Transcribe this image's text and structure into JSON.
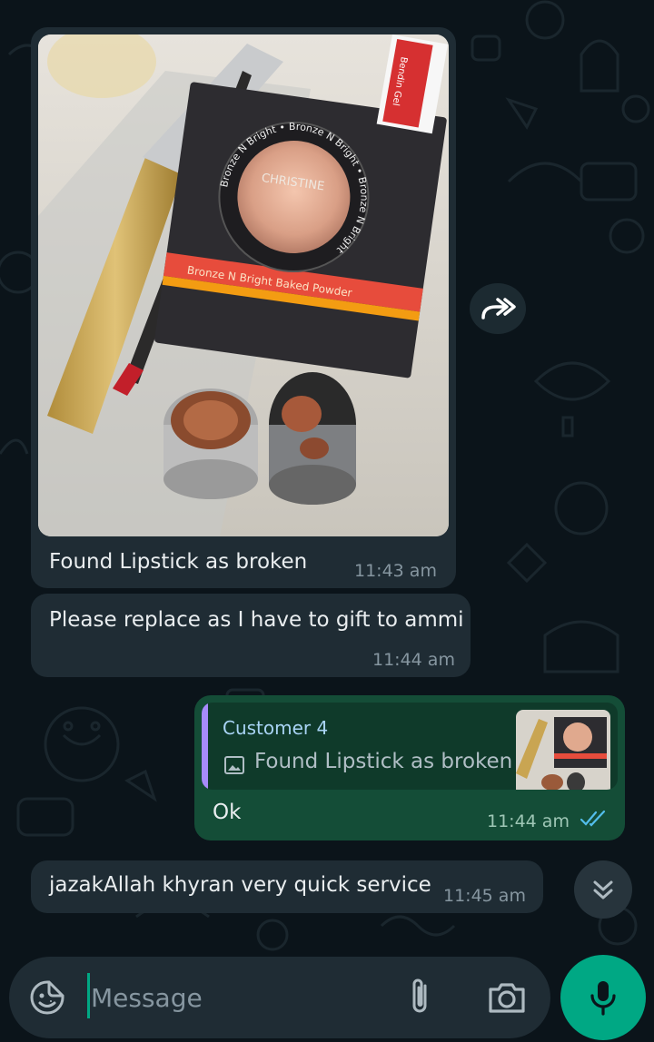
{
  "chat": {
    "messages": [
      {
        "type": "image",
        "direction": "incoming",
        "caption": "Found Lipstick as broken",
        "time": "11:43 am",
        "photo": {
          "box_lid_text": "Bronze N Bright Baked Powder",
          "ring_text": "Bronze N Bright • Bronze N Bright • Bronze N Bright",
          "logo_text": "CHRISTINE",
          "tube_text": "Bendin Gel"
        }
      },
      {
        "type": "text",
        "direction": "incoming",
        "text": "Please replace as I have to gift to ammi",
        "time": "11:44 am"
      },
      {
        "type": "reply",
        "direction": "outgoing",
        "quoted_author": "Customer 4",
        "quoted_text": "Found Lipstick as broken",
        "text": "Ok",
        "time": "11:44 am",
        "status": "read"
      },
      {
        "type": "text",
        "direction": "incoming",
        "text": "jazakAllah khyran very quick service",
        "time": "11:45 am"
      }
    ]
  },
  "composer": {
    "placeholder": "Message"
  },
  "icons": {
    "forward": "forward-icon",
    "scroll_down": "double-chevron-down-icon",
    "sticker": "sticker-icon",
    "attach": "paperclip-icon",
    "camera": "camera-icon",
    "mic": "microphone-icon",
    "quote_image": "image-icon",
    "read_ticks": "double-check-icon"
  },
  "colors": {
    "background": "#0b141a",
    "incoming_bubble": "#1f2c34",
    "outgoing_bubble": "#144d37",
    "accent": "#00a884",
    "read_ticks": "#53bdeb",
    "quote_bar": "#a78bfa"
  }
}
